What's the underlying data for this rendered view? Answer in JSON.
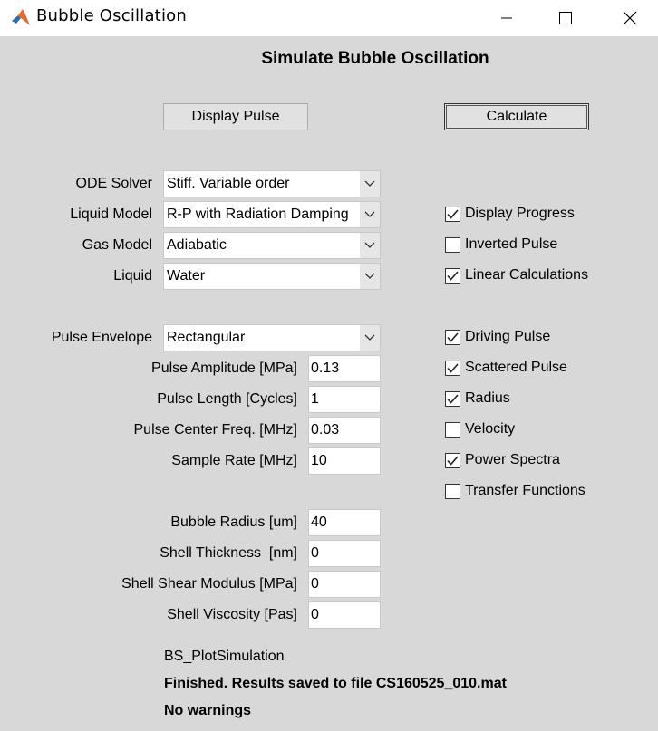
{
  "window": {
    "title": "Bubble Oscillation"
  },
  "heading": "Simulate Bubble Oscillation",
  "buttons": {
    "display_pulse": "Display Pulse",
    "calculate": "Calculate"
  },
  "dropdowns": {
    "ode_solver": {
      "label": "ODE Solver",
      "value": "Stiff. Variable order"
    },
    "liquid_model": {
      "label": "Liquid Model",
      "value": "R-P with Radiation Damping"
    },
    "gas_model": {
      "label": "Gas Model",
      "value": "Adiabatic"
    },
    "liquid": {
      "label": "Liquid",
      "value": "Water"
    },
    "pulse_envelope": {
      "label": "Pulse Envelope",
      "value": "Rectangular"
    }
  },
  "fields": {
    "pulse_amplitude": {
      "label": "Pulse Amplitude [MPa]",
      "value": "0.13"
    },
    "pulse_length": {
      "label": "Pulse Length [Cycles]",
      "value": "1"
    },
    "pulse_center_freq": {
      "label": "Pulse Center Freq. [MHz]",
      "value": "0.03"
    },
    "sample_rate": {
      "label": "Sample Rate [MHz]",
      "value": "10"
    },
    "bubble_radius": {
      "label": "Bubble Radius [um]",
      "value": "40"
    },
    "shell_thickness": {
      "label": "Shell Thickness  [nm]",
      "value": "0"
    },
    "shell_shear_modulus": {
      "label": "Shell Shear Modulus [MPa]",
      "value": "0"
    },
    "shell_viscosity": {
      "label": "Shell Viscosity [Pas]",
      "value": "0"
    }
  },
  "checkboxes": {
    "display_progress": {
      "label": "Display Progress",
      "checked": true
    },
    "inverted_pulse": {
      "label": "Inverted Pulse",
      "checked": false
    },
    "linear_calculations": {
      "label": "Linear Calculations",
      "checked": true
    },
    "driving_pulse": {
      "label": "Driving Pulse",
      "checked": true
    },
    "scattered_pulse": {
      "label": "Scattered Pulse",
      "checked": true
    },
    "radius": {
      "label": "Radius",
      "checked": true
    },
    "velocity": {
      "label": "Velocity",
      "checked": false
    },
    "power_spectra": {
      "label": "Power Spectra",
      "checked": true
    },
    "transfer_functions": {
      "label": "Transfer Functions",
      "checked": false
    }
  },
  "status": {
    "script": "BS_PlotSimulation",
    "result": "Finished. Results saved to file CS160525_010.mat",
    "warnings": "No warnings"
  }
}
